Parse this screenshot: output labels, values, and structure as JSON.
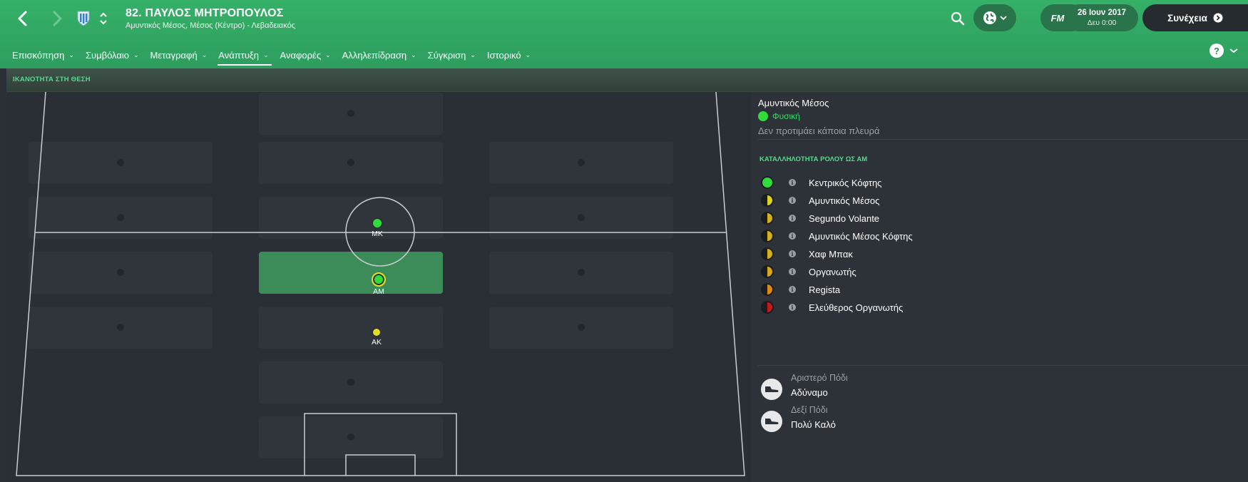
{
  "header": {
    "player_title": "82. ΠΑΥΛΟΣ ΜΗΤΡΟΠΟΥΛΟΣ",
    "player_subtitle": "Αμυντικός Μέσος, Μέσος (Κέντρο) - Λεβαδειακός",
    "date": "26 Ιουν 2017",
    "time": "Δευ 0:00",
    "continue_label": "Συνέχεια",
    "fm_label": "FM",
    "colors": {
      "header_green": "#35b168",
      "accent_green": "#57d98e"
    }
  },
  "tabs": [
    {
      "label": "Επισκόπηση",
      "active": false
    },
    {
      "label": "Συμβόλαιο",
      "active": false
    },
    {
      "label": "Μεταγραφή",
      "active": false
    },
    {
      "label": "Ανάπτυξη",
      "active": true
    },
    {
      "label": "Αναφορές",
      "active": false
    },
    {
      "label": "Αλληλεπίδραση",
      "active": false
    },
    {
      "label": "Σύγκριση",
      "active": false
    },
    {
      "label": "Ιστορικό",
      "active": false
    }
  ],
  "help_label": "?",
  "panel": {
    "title": "ΙΚΑΝΟΤΗΤΑ ΣΤΗ ΘΕΣΗ",
    "positions": [
      {
        "label": "ΜΚ",
        "color": "#2fdc3a"
      },
      {
        "label": "ΑΜ",
        "color": "#2fdc3a"
      },
      {
        "label": "ΑΚ",
        "color": "#e5dd20"
      }
    ]
  },
  "details": {
    "position_name": "Αμυντικός Μέσος",
    "natural_label": "Φυσική",
    "side_text": "Δεν προτιμάει κάποια πλευρά",
    "suitability_title": "ΚΑΤΑΛΛΗΛΟΤΗΤΑ ΡΟΛΟΥ ΩΣ ΑΜ",
    "roles": [
      {
        "name": "Κεντρικός Κόφτης",
        "color": "#2fdc3a",
        "fill": 1.0
      },
      {
        "name": "Αμυντικός Μέσος",
        "color": "#d8d222",
        "fill": 0.5
      },
      {
        "name": "Segundo Volante",
        "color": "#d4b019",
        "fill": 0.5
      },
      {
        "name": "Αμυντικός Μέσος Κόφτης",
        "color": "#d4b019",
        "fill": 0.5
      },
      {
        "name": "Χαφ Μπακ",
        "color": "#d4b019",
        "fill": 0.5
      },
      {
        "name": "Οργανωτής",
        "color": "#d4a819",
        "fill": 0.5
      },
      {
        "name": "Regista",
        "color": "#d98a18",
        "fill": 0.5
      },
      {
        "name": "Ελεύθερος Οργανωτής",
        "color": "#c41a1a",
        "fill": 0.5
      }
    ],
    "left_foot_label": "Αριστερό Πόδι",
    "left_foot_value": "Αδύναμο",
    "right_foot_label": "Δεξί Πόδι",
    "right_foot_value": "Πολύ Καλό"
  }
}
